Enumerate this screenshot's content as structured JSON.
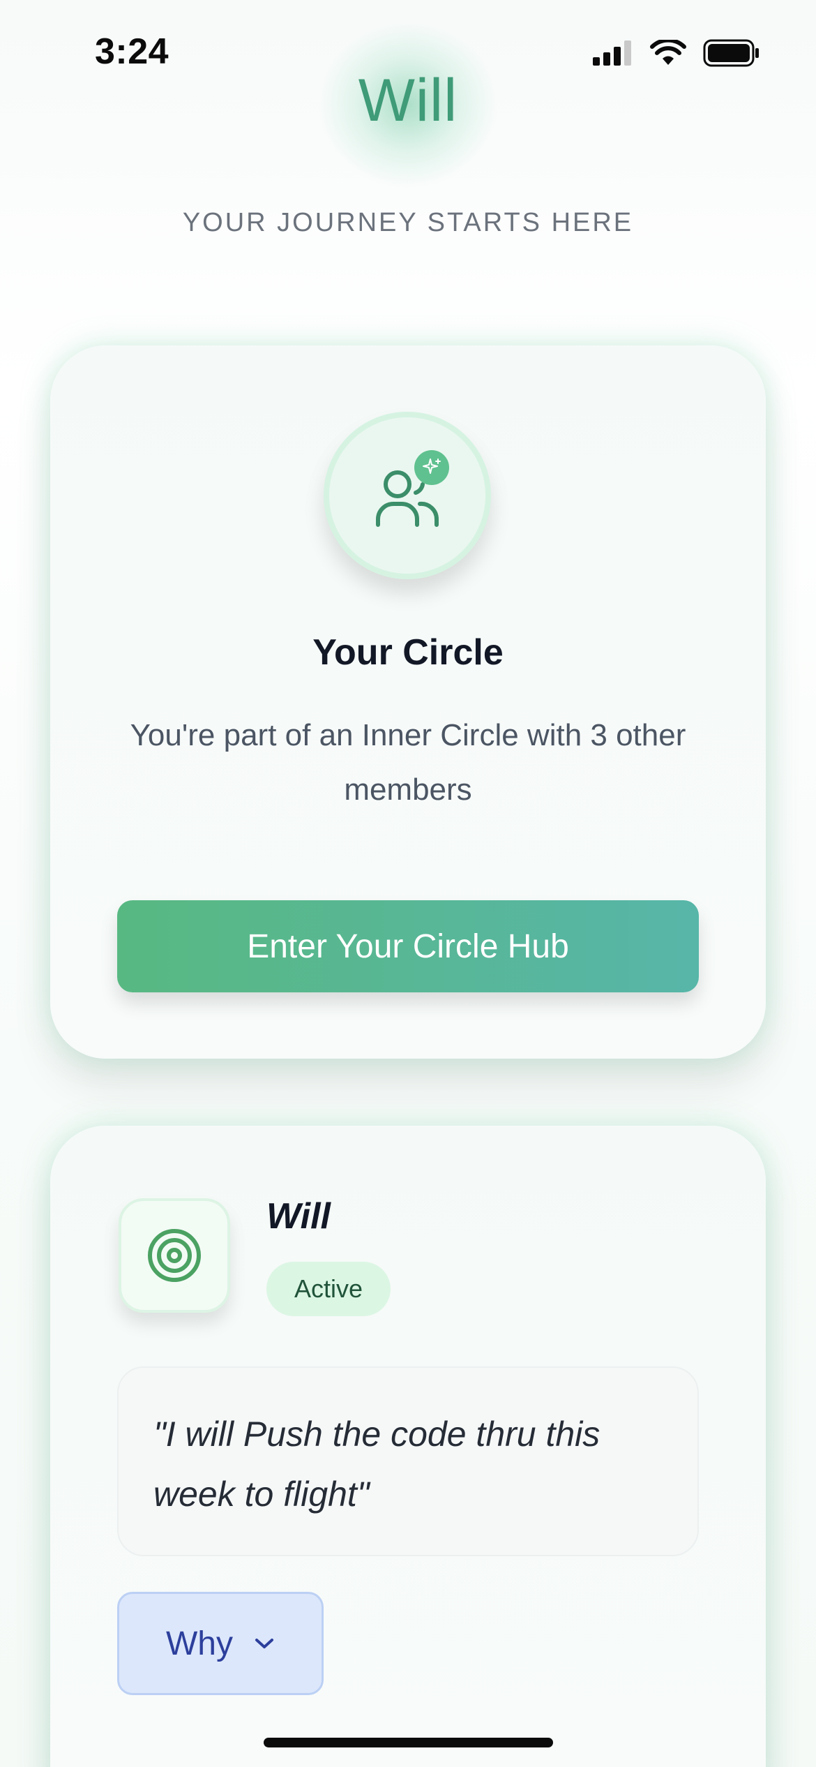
{
  "status_bar": {
    "time": "3:24",
    "icons": [
      "cellular-signal-icon",
      "wifi-icon",
      "battery-icon"
    ]
  },
  "header": {
    "title": "Will",
    "tagline": "YOUR JOURNEY STARTS HERE"
  },
  "circle_card": {
    "icon": "people-sparkle-icon",
    "title": "Your Circle",
    "description": "You're part of an Inner Circle with 3 other members",
    "button_label": "Enter Your Circle Hub"
  },
  "will_card": {
    "icon": "target-icon",
    "name": "Will",
    "status": "Active",
    "quote": "\"I will Push the code thru this week to flight\"",
    "why_label": "Why"
  },
  "colors": {
    "brand": "#3f9b78",
    "button_gradient_start": "#58b882",
    "button_gradient_end": "#57b6a8",
    "active_badge_bg": "#dcf6e4",
    "why_button_bg": "#dce7fb",
    "why_button_text": "#2c3f9c"
  }
}
